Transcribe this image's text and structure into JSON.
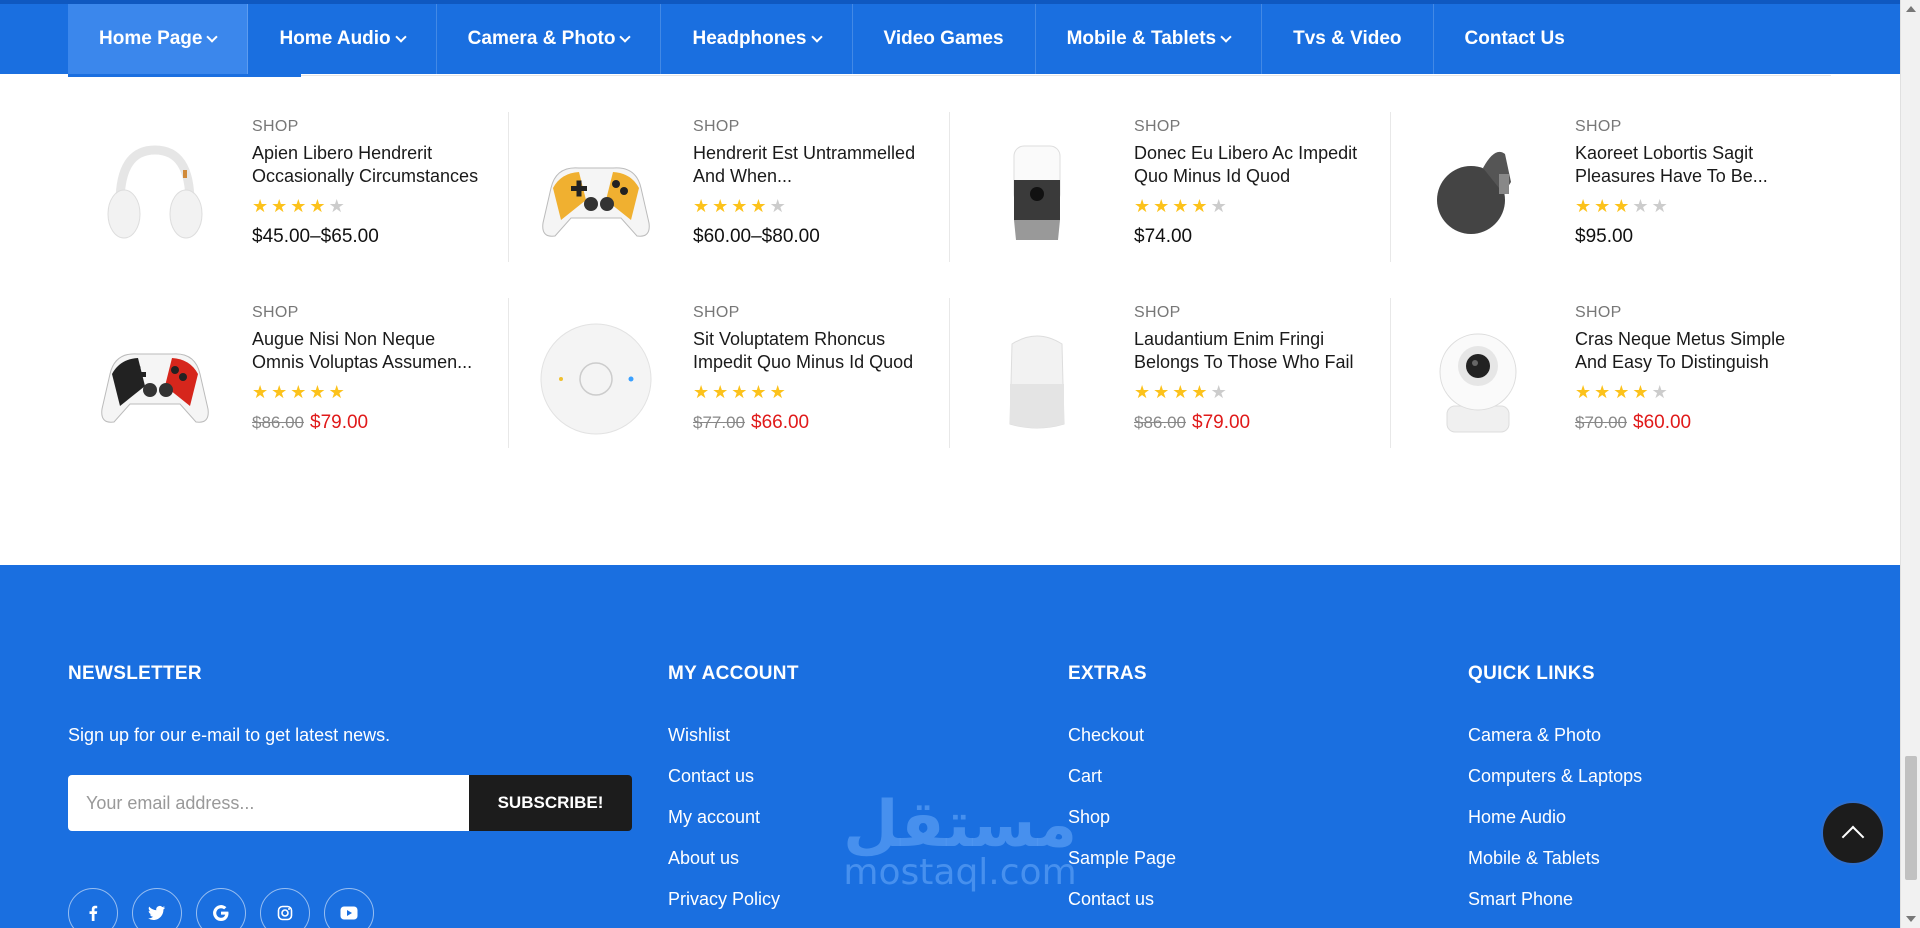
{
  "nav": {
    "items": [
      {
        "label": "Home Page",
        "dropdown": true,
        "active": true
      },
      {
        "label": "Home Audio",
        "dropdown": true
      },
      {
        "label": "Camera & Photo",
        "dropdown": true
      },
      {
        "label": "Headphones",
        "dropdown": true
      },
      {
        "label": "Video Games",
        "dropdown": false
      },
      {
        "label": "Mobile & Tablets",
        "dropdown": true
      },
      {
        "label": "Tvs & Video",
        "dropdown": false
      },
      {
        "label": "Contact Us",
        "dropdown": false
      }
    ]
  },
  "products": [
    {
      "category": "SHOP",
      "title": "Apien Libero Hendrerit Occasionally Circumstances",
      "rating": 4,
      "price": "$45.00–$65.00",
      "icon": "headphones-image"
    },
    {
      "category": "SHOP",
      "title": "Hendrerit Est Untrammelled And When...",
      "rating": 4,
      "price": "$60.00–$80.00",
      "icon": "game-controller-image"
    },
    {
      "category": "SHOP",
      "title": "Donec Eu Libero Ac Impedit Quo Minus Id Quod",
      "rating": 4,
      "price": "$74.00",
      "icon": "smart-speaker-image"
    },
    {
      "category": "SHOP",
      "title": "Kaoreet Lobortis Sagit Pleasures Have To Be...",
      "rating": 3,
      "price": "$95.00",
      "icon": "chromecast-image"
    },
    {
      "category": "SHOP",
      "title": "Augue Nisi Non Neque Omnis Voluptas Assumen...",
      "rating": 5,
      "old_price": "$86.00",
      "price": "$79.00",
      "icon": "game-controller-image"
    },
    {
      "category": "SHOP",
      "title": "Sit Voluptatem Rhoncus Impedit Quo Minus Id Quod",
      "rating": 5,
      "old_price": "$77.00",
      "price": "$66.00",
      "icon": "speaker-puck-image"
    },
    {
      "category": "SHOP",
      "title": "Laudantium Enim Fringi Belongs To Those Who Fail",
      "rating": 4,
      "old_price": "$86.00",
      "price": "$79.00",
      "icon": "google-home-image"
    },
    {
      "category": "SHOP",
      "title": "Cras Neque Metus Simple And Easy To Distinguish",
      "rating": 4,
      "old_price": "$70.00",
      "price": "$60.00",
      "icon": "security-camera-image"
    }
  ],
  "footer": {
    "newsletter": {
      "heading": "NEWSLETTER",
      "text": "Sign up for our e-mail to get latest news.",
      "placeholder": "Your email address...",
      "button": "SUBSCRIBE!"
    },
    "my_account": {
      "heading": "MY ACCOUNT",
      "links": [
        "Wishlist",
        "Contact us",
        "My account",
        "About us",
        "Privacy Policy"
      ]
    },
    "extras": {
      "heading": "EXTRAS",
      "links": [
        "Checkout",
        "Cart",
        "Shop",
        "Sample Page",
        "Contact us"
      ]
    },
    "quick_links": {
      "heading": "QUICK LINKS",
      "links": [
        "Camera & Photo",
        "Computers & Laptops",
        "Home Audio",
        "Mobile & Tablets",
        "Smart Phone"
      ]
    },
    "social": [
      "facebook-icon",
      "twitter-icon",
      "google-icon",
      "instagram-icon",
      "youtube-icon"
    ]
  },
  "watermark": {
    "arabic": "مستقل",
    "latin": "mostaql.com"
  },
  "colors": {
    "brand": "#1a6fe0",
    "star": "#fcc21b",
    "sale": "#e01a1a",
    "dark": "#1c1c1c"
  }
}
